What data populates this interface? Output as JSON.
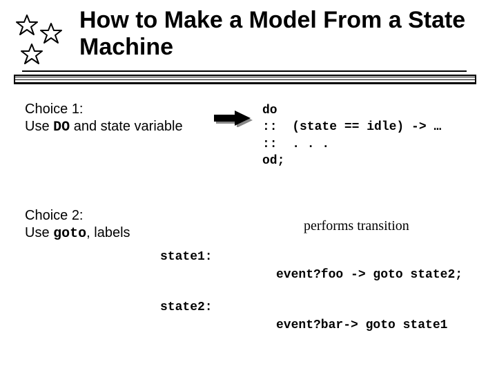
{
  "title": "How to Make a Model From a State Machine",
  "choice1": {
    "heading": "Choice 1:",
    "line_pre": "Use ",
    "line_mono": "DO",
    "line_post": " and state variable",
    "code_l1": "do",
    "code_l2": "::  (state == idle) -> …",
    "code_l3": "::  . . .",
    "code_l4": "od;"
  },
  "choice2": {
    "heading": "Choice 2:",
    "line_pre": "Use ",
    "line_mono": "goto",
    "line_post": ", labels",
    "perf": "performs transition",
    "state1": "state1:",
    "state2": "state2:",
    "ev1": "event?foo -> goto state2;",
    "ev2": "event?bar-> goto state1"
  }
}
